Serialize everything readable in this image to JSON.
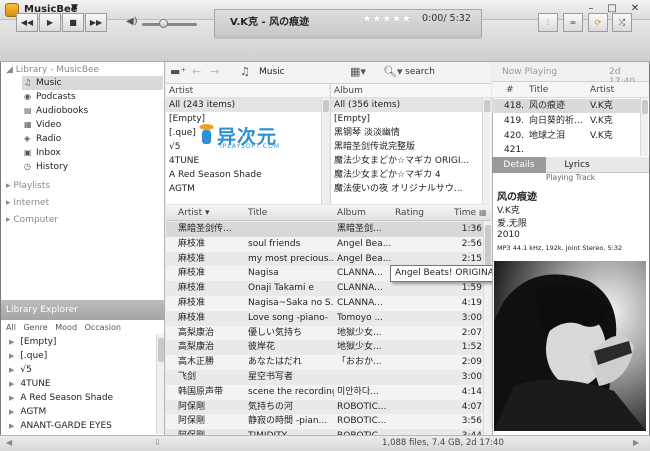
{
  "window": {
    "app_title": "MusicBee",
    "controls": {
      "minimize": "–",
      "maximize": "□",
      "close": "✕"
    }
  },
  "transport": {
    "now_playing": "V.K克 - 风の痕迹",
    "rating_stars": "★★★★★",
    "time": "0:00/ 5:32",
    "buttons": {
      "prev": "◀◀",
      "play": "▶",
      "stop": "■",
      "next": "▶▶"
    },
    "right_icons": [
      "equalizer-icon",
      "scrobble-icon",
      "repeat-icon",
      "shuffle-icon"
    ]
  },
  "sidebar": {
    "library_header": "Library - MusicBee",
    "items": [
      {
        "label": "Music",
        "icon": "music-note-icon"
      },
      {
        "label": "Podcasts",
        "icon": "podcast-icon"
      },
      {
        "label": "Audiobooks",
        "icon": "audiobook-icon"
      },
      {
        "label": "Video",
        "icon": "video-icon"
      },
      {
        "label": "Radio",
        "icon": "radio-icon"
      },
      {
        "label": "Inbox",
        "icon": "inbox-icon"
      },
      {
        "label": "History",
        "icon": "history-icon"
      }
    ],
    "playlists": "Playlists",
    "internet": "Internet",
    "computer": "Computer"
  },
  "library_explorer": {
    "title": "Library Explorer",
    "tabs": [
      "All",
      "Genre",
      "Mood",
      "Occasion"
    ],
    "rows": [
      "[Empty]",
      "[.que]",
      "√5",
      "4TUNE",
      "A Red Season Shade",
      "AGTM",
      "ANANT-GARDE EYES"
    ]
  },
  "browser": {
    "view_label": "Music",
    "search_label": "search",
    "artist_col": {
      "header": "Artist",
      "rows": [
        "All  (243 items)",
        "[Empty]",
        "[.que]",
        "√5",
        "4TUNE",
        "A Red Season Shade",
        "AGTM"
      ]
    },
    "album_col": {
      "header": "Album",
      "rows": [
        "All  (356 items)",
        "[Empty]",
        "黑钢琴 淡淡幽情",
        "黑暗圣剑传说完整版",
        "魔法少女まどか☆マギカ ORIGI...",
        "魔法少女まどか☆マギカ 4",
        "魔法使いの夜 オリジナルサウ..."
      ]
    }
  },
  "watermark": {
    "cn": "异次元",
    "en": "IPLAYSOFT.COM"
  },
  "tracklist": {
    "headers": {
      "artist": "Artist",
      "title": "Title",
      "album": "Album",
      "rating": "Rating",
      "time": "Time"
    },
    "rows": [
      {
        "artist": "黑暗圣剑传...",
        "title": "",
        "album": "黑暗圣剑...",
        "time": "1:36"
      },
      {
        "artist": "麻枝准",
        "title": "soul friends",
        "album": "Angel Bea...",
        "time": "2:56"
      },
      {
        "artist": "麻枝准",
        "title": "my most precious...",
        "album": "Angel Bea...",
        "time": "2:15"
      },
      {
        "artist": "麻枝准",
        "title": "Nagisa",
        "album": "CLANNA...",
        "time": "1:49"
      },
      {
        "artist": "麻枝准",
        "title": "Onaji Takami e",
        "album": "CLANNA...",
        "time": "1:59"
      },
      {
        "artist": "麻枝准",
        "title": "Nagisa~Saka no S...",
        "album": "CLANNA...",
        "time": "4:19"
      },
      {
        "artist": "麻枝准",
        "title": "Love song -piano-",
        "album": "Tomoyo ...",
        "time": "3:00"
      },
      {
        "artist": "高梨康治",
        "title": "優しい気持ち",
        "album": "地獄少女...",
        "time": "2:07"
      },
      {
        "artist": "高梨康治",
        "title": "彼岸花",
        "album": "地獄少女...",
        "time": "1:52"
      },
      {
        "artist": "高木正勝",
        "title": "あなたはだれ",
        "album": "「おおか...",
        "time": "2:09"
      },
      {
        "artist": "飞剑",
        "title": "星空书写者",
        "album": "",
        "time": "3:00"
      },
      {
        "artist": "韩国原声带",
        "title": "scene the recording",
        "album": "미안하다...",
        "time": "4:14"
      },
      {
        "artist": "阿保剛",
        "title": "気持ちの河",
        "album": "ROBOTIC...",
        "time": "4:07"
      },
      {
        "artist": "阿保剛",
        "title": "静寂の時間 -pian...",
        "album": "ROBOTIC...",
        "time": "3:56"
      },
      {
        "artist": "阿保剛",
        "title": "TIMIDITY",
        "album": "ROBOTIC...",
        "time": "3:44"
      }
    ]
  },
  "tooltip": "Angel Beats! ORIGINAL SOUNDTRACK",
  "now_playing_panel": {
    "header": "Now Playing",
    "time": "2d 17:40",
    "col_num": "#",
    "col_title": "Title",
    "col_artist": "Artist",
    "rows": [
      {
        "num": "418.",
        "title": "风の痕迹",
        "artist": "V.K克"
      },
      {
        "num": "419.",
        "title": "向日葵的祈...",
        "artist": "V.K克"
      },
      {
        "num": "420.",
        "title": "地球之泪",
        "artist": "V.K克"
      },
      {
        "num": "421.",
        "title": "",
        "artist": ""
      }
    ],
    "tabs": [
      "Details",
      "Lyrics"
    ],
    "playing_track": "Playing Track",
    "details": {
      "title": "风の痕迹",
      "artist": "V.K克",
      "album": "爱.无限",
      "year": "2010",
      "format": "MP3 44.1 kHz, 192k, Joint Stereo, 5:32"
    }
  },
  "status": {
    "summary": "1,088 files, 7.4 GB, 2d 17:40"
  }
}
